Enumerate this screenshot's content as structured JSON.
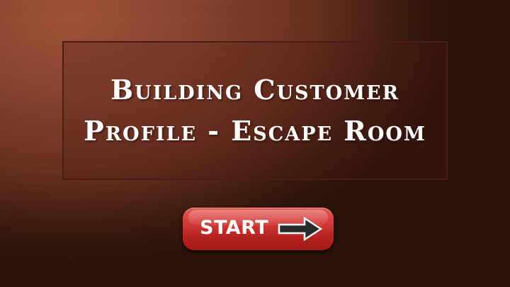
{
  "slide": {
    "title": "Building Customer Profile - Escape Room"
  },
  "start_button": {
    "label": "START",
    "icon": "arrow-right-icon"
  },
  "colors": {
    "background": "#8a4530",
    "title_box_border": "#4a1e14",
    "title_text": "#ffffff",
    "button": "#d33b38",
    "arrow_fill": "#2a2a2a"
  }
}
